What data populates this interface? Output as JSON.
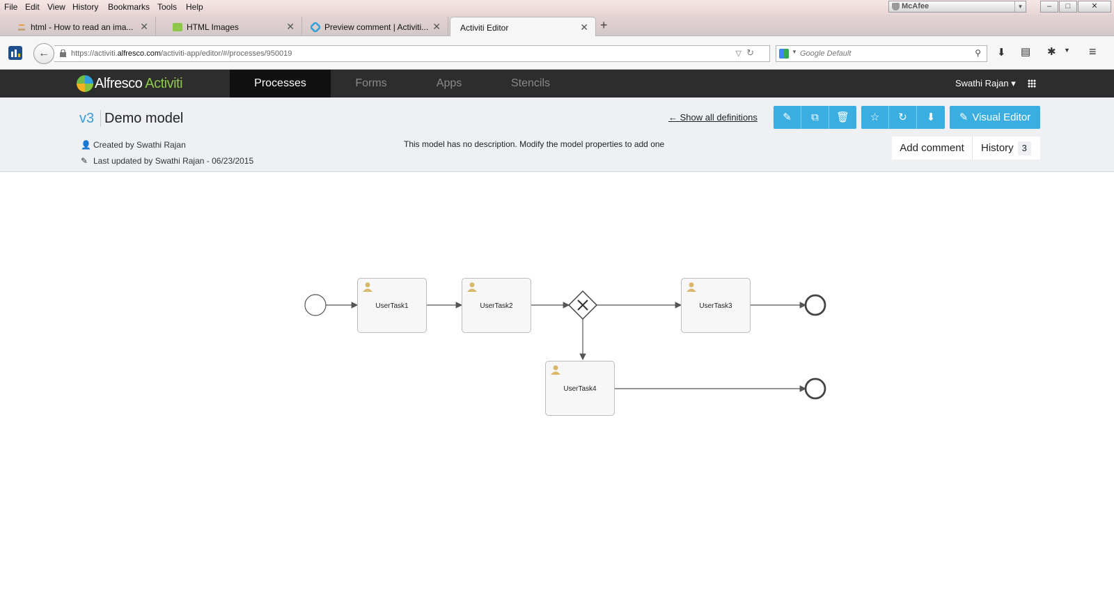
{
  "browser": {
    "menu": [
      "File",
      "Edit",
      "View",
      "History",
      "Bookmarks",
      "Tools",
      "Help"
    ],
    "mcafee_label": "McAfee",
    "window_controls": [
      "–",
      "□",
      "✕"
    ],
    "tabs": [
      {
        "title": "html - How to read an ima..."
      },
      {
        "title": "HTML Images"
      },
      {
        "title": "Preview comment | Activiti..."
      },
      {
        "title": "Activiti Editor"
      }
    ],
    "new_tab": "+",
    "url_prefix": "https://activiti.",
    "url_host": "alfresco.com",
    "url_path": "/activiti-app/editor/#/processes/950019",
    "search_placeholder": "Google Default"
  },
  "app": {
    "brand_main": "Alfresco",
    "brand_sub": "Activiti",
    "nav": [
      "Processes",
      "Forms",
      "Apps",
      "Stencils"
    ],
    "user": "Swathi Rajan ▾"
  },
  "model": {
    "version": "v3",
    "name": "Demo model",
    "created_by": "Created by Swathi Rajan",
    "updated_by": "Last updated by Swathi Rajan - 06/23/2015",
    "description": "This model has no description. Modify the model properties to add one",
    "show_all": "← Show all definitions",
    "visual_editor": "Visual Editor",
    "add_comment": "Add comment",
    "history": "History",
    "history_count": "3"
  },
  "diagram": {
    "tasks": [
      "UserTask1",
      "UserTask2",
      "UserTask3",
      "UserTask4"
    ]
  },
  "colors": {
    "accent": "#3aaee0",
    "brand_green": "#8ec74a",
    "header_dark": "#2d2d2d"
  }
}
